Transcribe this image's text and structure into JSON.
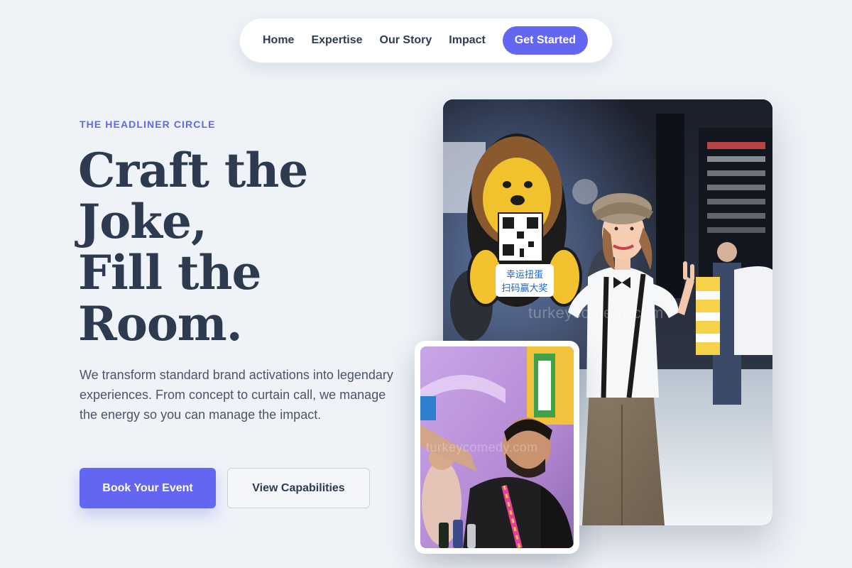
{
  "nav": {
    "links": [
      "Home",
      "Expertise",
      "Our Story",
      "Impact"
    ],
    "cta": "Get Started"
  },
  "hero": {
    "eyebrow": "THE HEADLINER CIRCLE",
    "headline": [
      "Craft the",
      "Joke,",
      "Fill the",
      "Room."
    ],
    "lead": "We transform standard brand activations into legendary experiences. From concept to curtain call, we manage the energy so you can manage the impact.",
    "primary_button": "Book Your Event",
    "secondary_button": "View Capabilities"
  },
  "images": {
    "main_watermark": "turkeycomedy.com",
    "small_watermark": "turkeycomedy.com",
    "sign_text": [
      "幸运扭蛋",
      "扫码赢大奖"
    ]
  },
  "colors": {
    "accent": "#6366f1",
    "heading": "#2d3a4f",
    "background": "#eff3f8"
  }
}
